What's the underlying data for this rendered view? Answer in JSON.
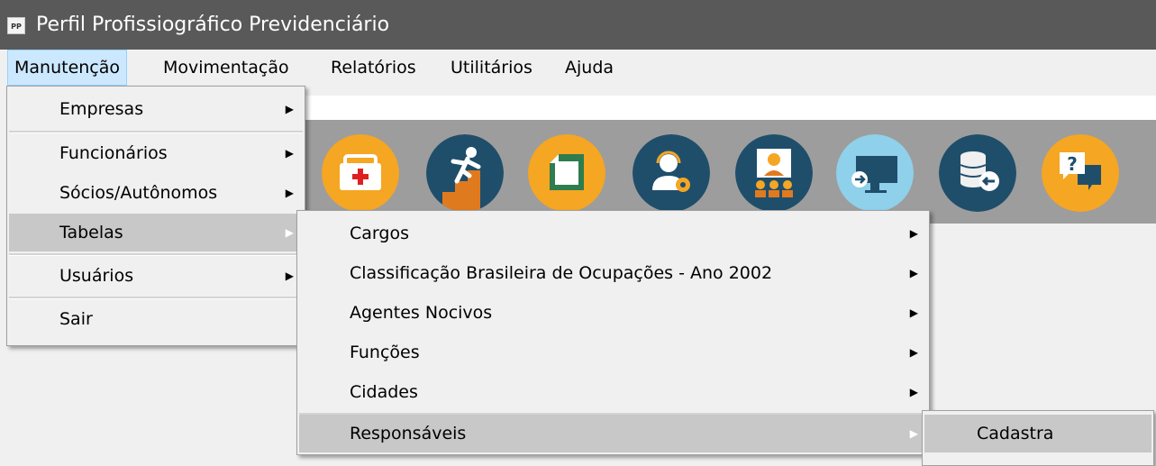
{
  "window": {
    "title": "Perfil Profissiográfico Previdenciário",
    "icon_text": "PP"
  },
  "menubar": {
    "items": [
      {
        "label": "Manutenção"
      },
      {
        "label": "Movimentação"
      },
      {
        "label": "Relatórios"
      },
      {
        "label": "Utilitários"
      },
      {
        "label": "Ajuda"
      }
    ]
  },
  "toolbar": {
    "buttons": [
      {
        "icon": "first-aid-kit-icon",
        "bg": "#f5a623"
      },
      {
        "icon": "falling-person-stairs-icon",
        "bg": "#1f4e6b"
      },
      {
        "icon": "document-icon",
        "bg": "#f5a623"
      },
      {
        "icon": "support-agent-gear-icon",
        "bg": "#1f4e6b"
      },
      {
        "icon": "meeting-presentation-icon",
        "bg": "#1f4e6b"
      },
      {
        "icon": "monitor-exit-icon",
        "bg": "#8fd0ea"
      },
      {
        "icon": "database-back-icon",
        "bg": "#1f4e6b"
      },
      {
        "icon": "help-chat-icon",
        "bg": "#f5a623"
      }
    ]
  },
  "menu_manutencao": {
    "items": [
      {
        "label": "Empresas",
        "submenu": true
      },
      {
        "label": "Funcionários",
        "submenu": true
      },
      {
        "label": "Sócios/Autônomos",
        "submenu": true
      },
      {
        "label": "Tabelas",
        "submenu": true,
        "highlighted": true
      },
      {
        "label": "Usuários",
        "submenu": true
      },
      {
        "label": "Sair",
        "submenu": false
      }
    ]
  },
  "menu_tabelas": {
    "items": [
      {
        "label": "Cargos",
        "submenu": true
      },
      {
        "label": "Classificação Brasileira de Ocupações - Ano 2002",
        "submenu": true
      },
      {
        "label": "Agentes Nocivos",
        "submenu": true
      },
      {
        "label": "Funções",
        "submenu": true
      },
      {
        "label": "Cidades",
        "submenu": true
      },
      {
        "label": "Responsáveis",
        "submenu": true,
        "highlighted": true
      }
    ]
  },
  "menu_responsaveis": {
    "items": [
      {
        "label": "Cadastra"
      }
    ]
  },
  "glyphs": {
    "submenu_arrow": "▶"
  }
}
